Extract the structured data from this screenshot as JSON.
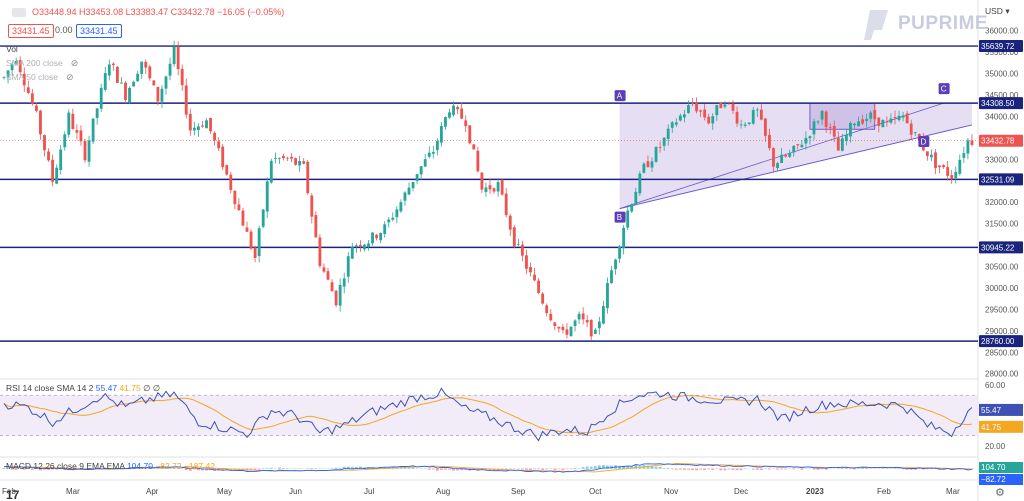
{
  "header": {
    "ohlc_text": "O33448.94 H33453.08 L33383.47 C33432.78 −16.05 (−0.05%)",
    "price_box_left": "33431.45",
    "price_box_mid": "0.00",
    "price_box_right": "33431.45",
    "vol_label": "Vol",
    "sma200_label": "SMA 200 close",
    "sma50_label": "SMA 50 close",
    "currency": "USD",
    "brand": "PUPRIME"
  },
  "rsi_pane": {
    "label": "RSI 14 close SMA 14 2",
    "v1": "55.47",
    "v2": "41.75",
    "v3": "∅ ∅",
    "badge_rsi": "55.47",
    "badge_sma": "41.75",
    "ticks": [
      "60.00",
      "20.00"
    ]
  },
  "macd_pane": {
    "label": "MACD 12 26 close 9 EMA EMA",
    "v1": "104.70",
    "v2": "−82.72",
    "v3": "−187.42",
    "badge_macd": "104.70",
    "badge_signal": "−82.72"
  },
  "colors": {
    "up": "#26a69a",
    "down": "#ef5350",
    "level": "#1a237e",
    "pattern_fill": "#d1c4e9",
    "rsi_line": "#3f51b5",
    "rsi_sma": "#f5a623",
    "marker": "#5c3fb8"
  },
  "chart_data": {
    "type": "candlestick",
    "title": "",
    "ylim": [
      27900,
      36200
    ],
    "y_ticks": [
      36000,
      35500,
      35000,
      34500,
      34000,
      33500,
      33000,
      32500,
      32000,
      31500,
      31000,
      30500,
      30000,
      29500,
      29000,
      28500,
      28000
    ],
    "x_labels": [
      "Feb",
      "Mar",
      "Apr",
      "May",
      "Jun",
      "Jul",
      "Aug",
      "Sep",
      "Oct",
      "Nov",
      "Dec",
      "2023",
      "Feb",
      "Mar"
    ],
    "last_price": "33432.78",
    "horizontal_levels": [
      {
        "value": 35639.72,
        "label": "35639.72"
      },
      {
        "value": 34308.5,
        "label": "34308.50"
      },
      {
        "value": 32531.09,
        "label": "32531.09"
      },
      {
        "value": 30945.22,
        "label": "30945.22"
      },
      {
        "value": 28760.0,
        "label": "28760.00"
      }
    ],
    "pattern_markers": [
      "A",
      "B",
      "C",
      "D"
    ],
    "anchors": [
      [
        0,
        34900
      ],
      [
        3,
        35400
      ],
      [
        8,
        34000
      ],
      [
        12,
        32500
      ],
      [
        16,
        34000
      ],
      [
        20,
        33100
      ],
      [
        26,
        35300
      ],
      [
        30,
        34500
      ],
      [
        34,
        35300
      ],
      [
        38,
        34400
      ],
      [
        42,
        35500
      ],
      [
        46,
        33700
      ],
      [
        50,
        33900
      ],
      [
        54,
        32900
      ],
      [
        58,
        31800
      ],
      [
        62,
        30700
      ],
      [
        66,
        33000
      ],
      [
        70,
        33000
      ],
      [
        74,
        32800
      ],
      [
        78,
        30600
      ],
      [
        82,
        29700
      ],
      [
        86,
        31000
      ],
      [
        90,
        31100
      ],
      [
        94,
        31400
      ],
      [
        98,
        32000
      ],
      [
        102,
        32700
      ],
      [
        106,
        33200
      ],
      [
        110,
        34200
      ],
      [
        114,
        33900
      ],
      [
        118,
        32300
      ],
      [
        122,
        32400
      ],
      [
        126,
        31100
      ],
      [
        130,
        30300
      ],
      [
        134,
        29500
      ],
      [
        138,
        28900
      ],
      [
        142,
        29300
      ],
      [
        146,
        28900
      ],
      [
        150,
        30400
      ],
      [
        154,
        31800
      ],
      [
        158,
        32800
      ],
      [
        162,
        33300
      ],
      [
        166,
        33900
      ],
      [
        170,
        34300
      ],
      [
        174,
        33900
      ],
      [
        178,
        34400
      ],
      [
        182,
        33800
      ],
      [
        186,
        34100
      ],
      [
        190,
        32900
      ],
      [
        194,
        33100
      ],
      [
        198,
        33500
      ],
      [
        202,
        34100
      ],
      [
        206,
        33200
      ],
      [
        210,
        33900
      ],
      [
        214,
        34000
      ],
      [
        218,
        33800
      ],
      [
        222,
        34000
      ],
      [
        226,
        33400
      ],
      [
        230,
        32900
      ],
      [
        234,
        32600
      ],
      [
        238,
        33430
      ]
    ],
    "rsi_anchors": [
      [
        0,
        62
      ],
      [
        6,
        58
      ],
      [
        12,
        44
      ],
      [
        18,
        57
      ],
      [
        24,
        70
      ],
      [
        30,
        58
      ],
      [
        36,
        66
      ],
      [
        42,
        71
      ],
      [
        48,
        44
      ],
      [
        54,
        38
      ],
      [
        60,
        32
      ],
      [
        66,
        55
      ],
      [
        72,
        50
      ],
      [
        78,
        33
      ],
      [
        84,
        40
      ],
      [
        90,
        52
      ],
      [
        96,
        60
      ],
      [
        102,
        68
      ],
      [
        108,
        72
      ],
      [
        114,
        56
      ],
      [
        120,
        48
      ],
      [
        126,
        38
      ],
      [
        132,
        30
      ],
      [
        138,
        36
      ],
      [
        144,
        34
      ],
      [
        150,
        56
      ],
      [
        156,
        70
      ],
      [
        162,
        72
      ],
      [
        168,
        68
      ],
      [
        174,
        66
      ],
      [
        180,
        63
      ],
      [
        186,
        66
      ],
      [
        192,
        46
      ],
      [
        198,
        56
      ],
      [
        204,
        62
      ],
      [
        210,
        61
      ],
      [
        216,
        62
      ],
      [
        222,
        60
      ],
      [
        228,
        40
      ],
      [
        234,
        33
      ],
      [
        238,
        55
      ]
    ],
    "macd_anchors": [
      [
        0,
        0.2
      ],
      [
        20,
        -0.1
      ],
      [
        40,
        0.2
      ],
      [
        60,
        -0.3
      ],
      [
        80,
        -0.2
      ],
      [
        100,
        0.3
      ],
      [
        120,
        -0.2
      ],
      [
        140,
        -0.4
      ],
      [
        160,
        0.6
      ],
      [
        180,
        0.3
      ],
      [
        200,
        0.1
      ],
      [
        220,
        0.1
      ],
      [
        238,
        -0.1
      ]
    ]
  }
}
